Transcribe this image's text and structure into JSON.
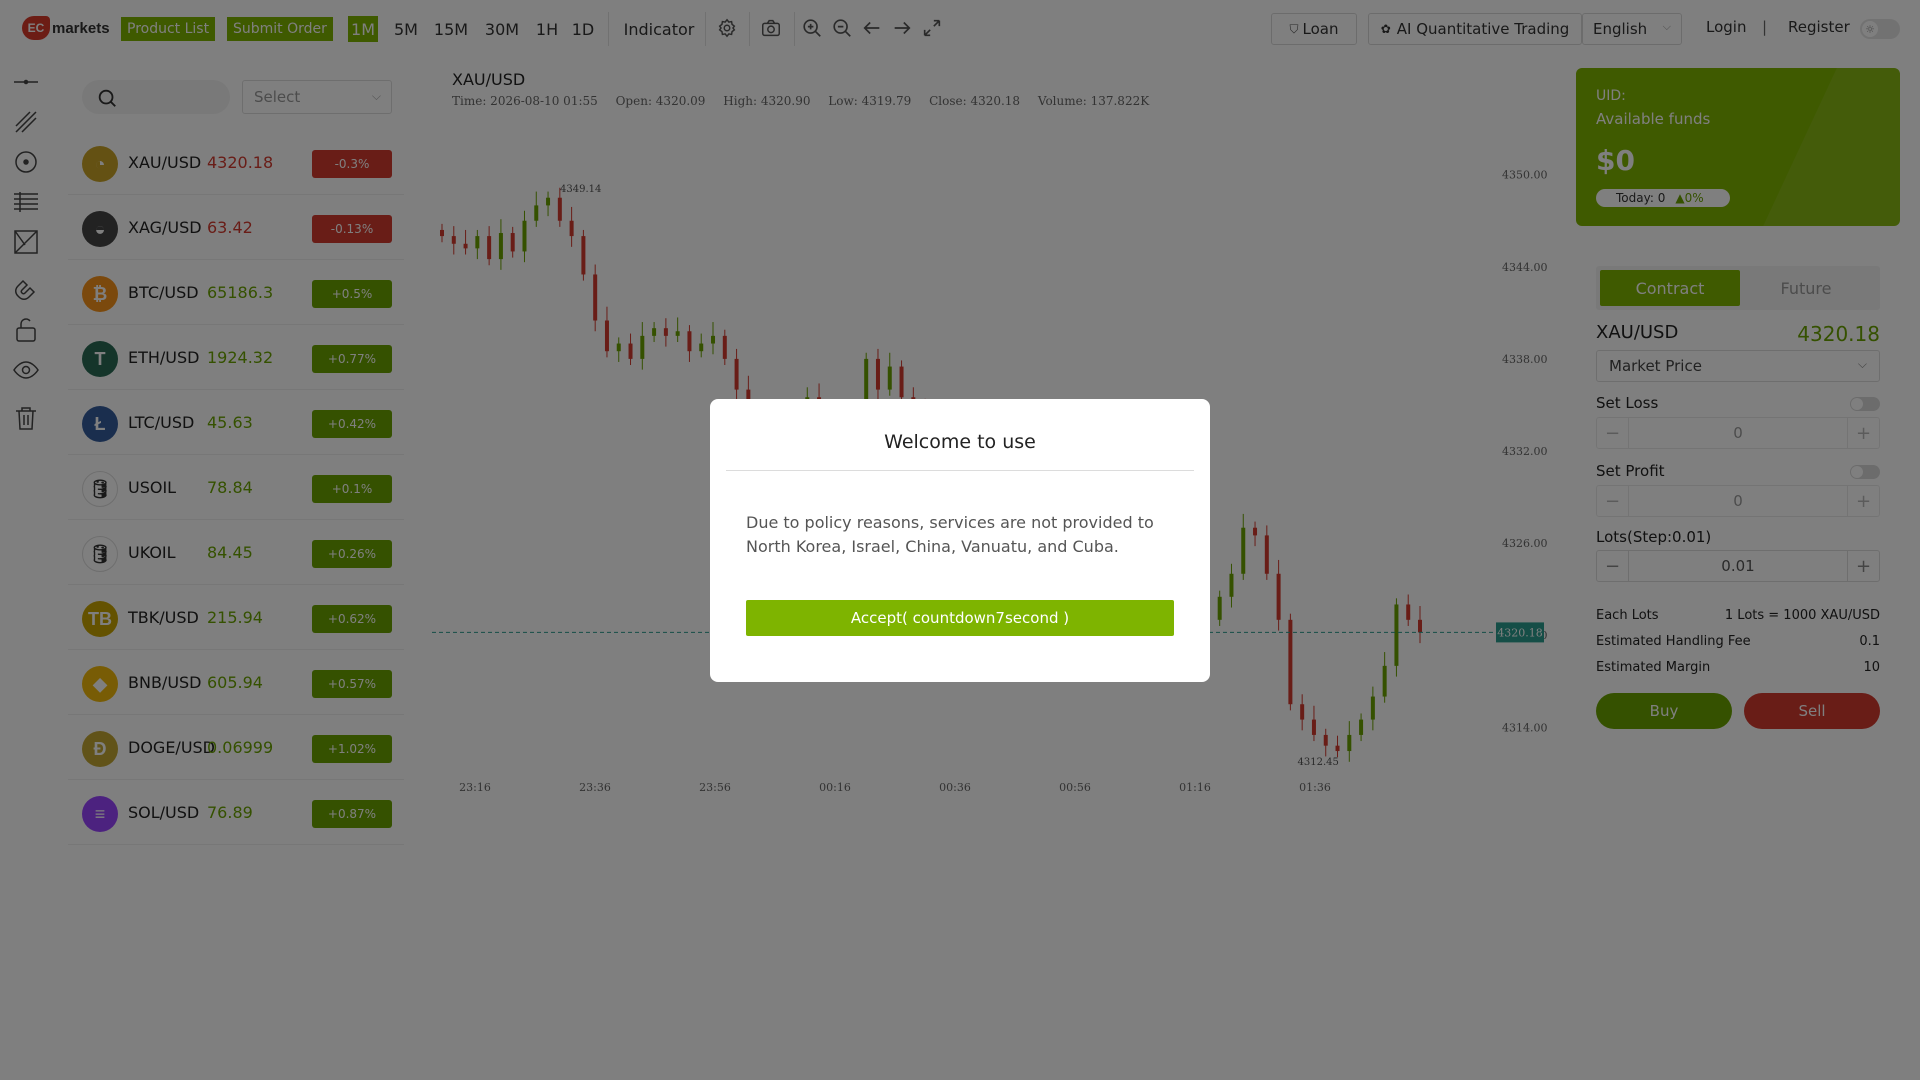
{
  "brand": {
    "logo_mark": "EC",
    "logo_text": "markets"
  },
  "toolbar": {
    "product_list": "Product List",
    "submit_order": "Submit Order",
    "timeframes": [
      "1M",
      "5M",
      "15M",
      "30M",
      "1H",
      "1D"
    ],
    "active_timeframe": "1M",
    "indicator": "Indicator"
  },
  "header": {
    "loan": "Loan",
    "ai_trading": "AI Quantitative Trading",
    "language": "English",
    "login": "Login",
    "separator": "|",
    "register": "Register"
  },
  "product_search": {
    "select_placeholder": "Select"
  },
  "products": [
    {
      "name": "XAU/USD",
      "price": "4320.18",
      "change": "-0.3%",
      "dir": "down",
      "color": "#c9a227",
      "glyph": "◔"
    },
    {
      "name": "XAG/USD",
      "price": "63.42",
      "change": "-0.13%",
      "dir": "down",
      "color": "#444444",
      "glyph": "◒"
    },
    {
      "name": "BTC/USD",
      "price": "65186.3",
      "change": "+0.5%",
      "dir": "up",
      "color": "#f7931a",
      "glyph": "₿"
    },
    {
      "name": "ETH/USD",
      "price": "1924.32",
      "change": "+0.77%",
      "dir": "up",
      "color": "#2a6b55",
      "glyph": "T"
    },
    {
      "name": "LTC/USD",
      "price": "45.63",
      "change": "+0.42%",
      "dir": "up",
      "color": "#345d9d",
      "glyph": "Ł"
    },
    {
      "name": "USOIL",
      "price": "78.84",
      "change": "+0.1%",
      "dir": "up",
      "color": "#ffffff",
      "glyph": "🛢"
    },
    {
      "name": "UKOIL",
      "price": "84.45",
      "change": "+0.26%",
      "dir": "up",
      "color": "#ffffff",
      "glyph": "🛢"
    },
    {
      "name": "TBK/USD",
      "price": "215.94",
      "change": "+0.62%",
      "dir": "up",
      "color": "#c8a400",
      "glyph": "TB"
    },
    {
      "name": "BNB/USD",
      "price": "605.94",
      "change": "+0.57%",
      "dir": "up",
      "color": "#f0b90b",
      "glyph": "◆"
    },
    {
      "name": "DOGE/USD",
      "price": "0.06999",
      "change": "+1.02%",
      "dir": "up",
      "color": "#c2a633",
      "glyph": "Ð"
    },
    {
      "name": "SOL/USD",
      "price": "76.89",
      "change": "+0.87%",
      "dir": "up",
      "color": "#9945ff",
      "glyph": "≡"
    }
  ],
  "chart": {
    "symbol": "XAU/USD",
    "time": "Time: 2026-08-10 01:55",
    "open": "Open: 4320.09",
    "high": "High: 4320.90",
    "low": "Low: 4319.79",
    "close": "Close: 4320.18",
    "volume": "Volume: 137.822K",
    "max_label": "4349.14",
    "min_label": "4312.45",
    "last_price": "4320.18",
    "y_ticks": [
      "4350.00",
      "4344.00",
      "4338.00",
      "4332.00",
      "4326.00",
      "4320.00",
      "4314.00"
    ],
    "x_ticks": [
      "23:16",
      "23:36",
      "23:56",
      "00:16",
      "00:36",
      "00:56",
      "01:16",
      "01:36"
    ],
    "up_color": "#6aa300",
    "down_color": "#d33a2f"
  },
  "chart_data": {
    "type": "candlestick",
    "title": "XAU/USD",
    "ylim": [
      4309,
      4352
    ],
    "y_ticks": [
      4314,
      4320,
      4326,
      4332,
      4338,
      4344,
      4350
    ],
    "x_tick_labels": [
      "23:16",
      "23:36",
      "23:56",
      "00:16",
      "00:36",
      "00:56",
      "01:16",
      "01:36"
    ],
    "close_path": [
      4346.0,
      4345.5,
      4345.2,
      4346.0,
      4344.5,
      4346.2,
      4345.0,
      4347.0,
      4348.0,
      4348.5,
      4347.0,
      4346.0,
      4343.5,
      4340.5,
      4338.5,
      4339.0,
      4338.0,
      4339.5,
      4340.0,
      4339.5,
      4339.8,
      4338.5,
      4339.0,
      4339.5,
      4338.0,
      4336.0,
      4331.0,
      4328.0,
      4330.0,
      4332.0,
      4334.0,
      4335.5,
      4334.0,
      4332.0,
      4331.0,
      4330.0,
      4338.0,
      4336.0,
      4337.5,
      4335.5,
      4334.5,
      4333.0,
      4332.5,
      4333.5,
      4332.5,
      4332.0,
      4333.0,
      4332.0,
      4331.0,
      4332.5,
      4334.0,
      4333.0,
      4332.5,
      4331.0,
      4330.0,
      4331.0,
      4330.0,
      4331.5,
      4330.0,
      4328.5,
      4334.0,
      4332.0,
      4320.0,
      4325.0,
      4323.0,
      4321.0,
      4322.5,
      4324.0,
      4327.0,
      4326.5,
      4324.0,
      4321.0,
      4315.5,
      4314.5,
      4313.5,
      4312.8,
      4312.45,
      4313.5,
      4314.5,
      4316.0,
      4318.0,
      4322.0,
      4321.0,
      4320.18
    ],
    "last": 4320.18,
    "max": 4349.14,
    "min": 4312.45
  },
  "account": {
    "uid": "UID:",
    "available_funds": "Available funds",
    "balance": "$0",
    "today": "Today: 0",
    "today_pct": "0%"
  },
  "order": {
    "tab_contract": "Contract",
    "tab_future": "Future",
    "symbol": "XAU/USD",
    "price": "4320.18",
    "order_type": "Market Price",
    "set_loss": "Set Loss",
    "loss_value": "0",
    "set_profit": "Set Profit",
    "profit_value": "0",
    "lots_label": "Lots(Step:0.01)",
    "lots_value": "0.01",
    "each_lots": "Each Lots",
    "each_lots_value": "1 Lots = 1000 XAU/USD",
    "fee_label": "Estimated Handling Fee",
    "fee_value": "0.1",
    "margin_label": "Estimated Margin",
    "margin_value": "10",
    "buy": "Buy",
    "sell": "Sell"
  },
  "modal": {
    "title": "Welcome to use",
    "body": "Due to policy reasons, services are not provided to North Korea, Israel, China, Vanuatu, and Cuba.",
    "accept": "Accept( countdown7second )"
  },
  "theme": {
    "accent": "#7eb400"
  }
}
